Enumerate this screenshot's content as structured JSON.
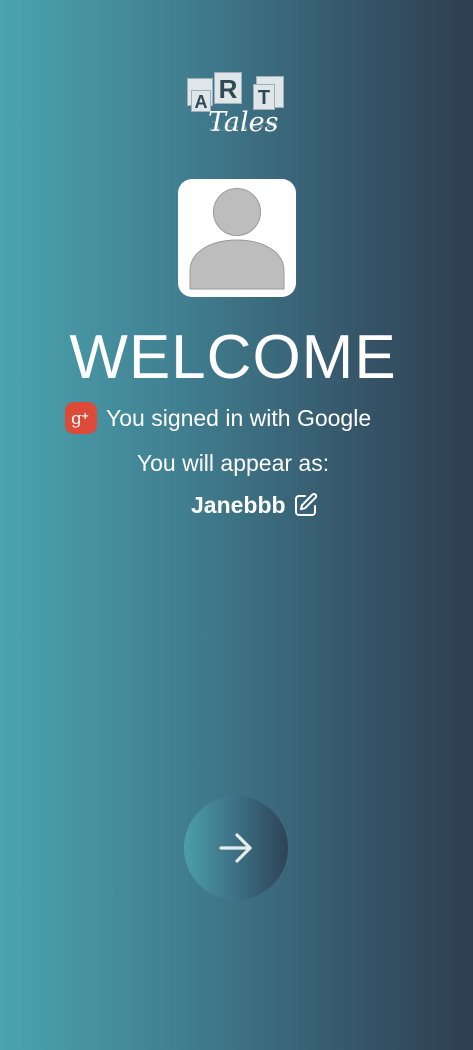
{
  "logo": {
    "letters": [
      "A",
      "R",
      "T"
    ],
    "script_text": "Tales"
  },
  "avatar": {
    "icon": "user-placeholder-icon"
  },
  "welcome": {
    "title": "WELCOME"
  },
  "signin": {
    "icon": "google-plus-icon",
    "text": "You signed in with Google",
    "brand_color": "#dc4a38"
  },
  "profile": {
    "appear_label": "You will appear as:",
    "username": "Janebbb",
    "edit_icon": "edit-pencil-icon"
  },
  "actions": {
    "next_icon": "arrow-right-icon"
  },
  "colors": {
    "background_start": "#4ba4b0",
    "background_end": "#2e3f51",
    "text": "#ffffff"
  }
}
